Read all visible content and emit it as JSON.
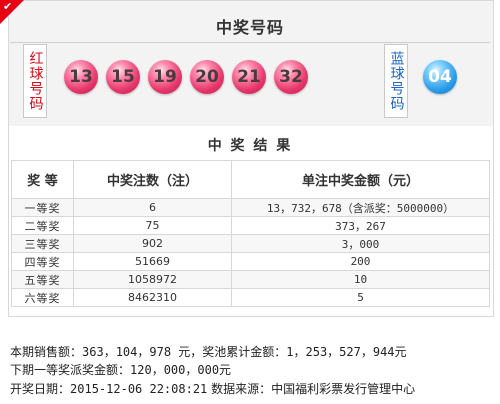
{
  "header": {
    "title": "中奖号码",
    "red_label": "红球号码",
    "blue_label": "蓝球号码"
  },
  "balls": {
    "red": [
      "13",
      "15",
      "19",
      "20",
      "21",
      "32"
    ],
    "blue": [
      "04"
    ]
  },
  "results": {
    "title": "中 奖 结 果",
    "columns": [
      "奖 等",
      "中奖注数（注）",
      "单注中奖金额（元）"
    ],
    "rows": [
      {
        "level": "一等奖",
        "count": "6",
        "amount": "13，732，678（含派奖：5000000）"
      },
      {
        "level": "二等奖",
        "count": "75",
        "amount": "373，267"
      },
      {
        "level": "三等奖",
        "count": "902",
        "amount": "3，000"
      },
      {
        "level": "四等奖",
        "count": "51669",
        "amount": "200"
      },
      {
        "level": "五等奖",
        "count": "1058972",
        "amount": "10"
      },
      {
        "level": "六等奖",
        "count": "8462310",
        "amount": "5"
      }
    ]
  },
  "footer": {
    "sales_label": "本期销售额：",
    "sales_value": "363，104，978 元",
    "pool_label": "，奖池累计金额：",
    "pool_value": "1，253，527，944元",
    "next_label": "下期一等奖派奖金额：",
    "next_value": "120，000，000元",
    "date_label": "开奖日期：",
    "date_value": "2015-12-06 22:08:21",
    "source_label": " 数据来源：",
    "source_value": "中国福利彩票发行管理中心"
  },
  "colors": {
    "red_ball": "#e7386c",
    "blue_ball": "#2b9de8",
    "red_text": "#d60a17",
    "blue_text": "#1a64c8"
  }
}
